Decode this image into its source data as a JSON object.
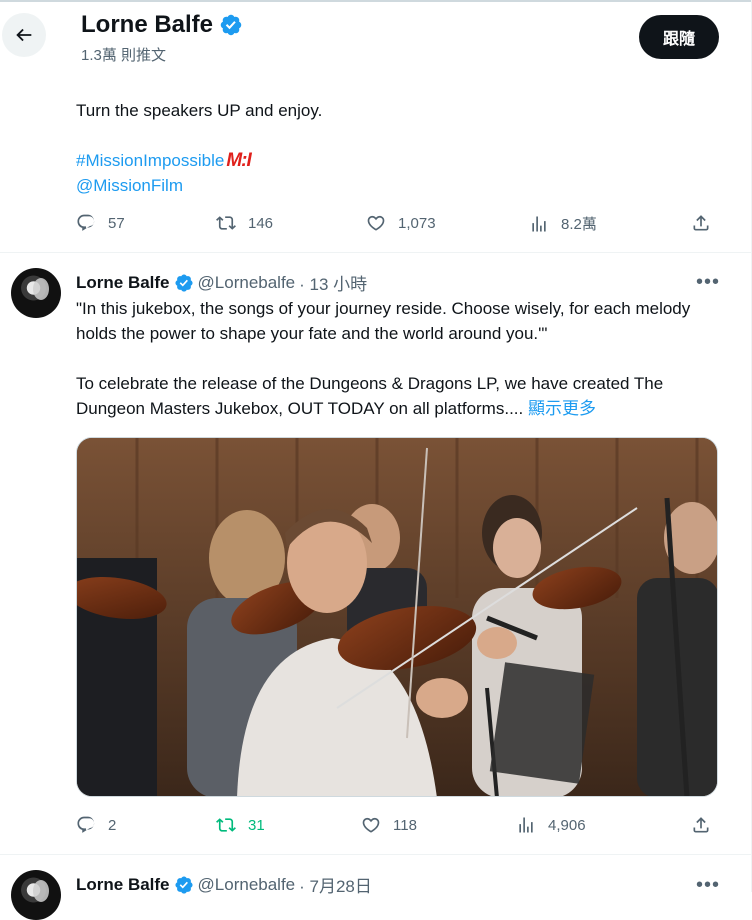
{
  "header": {
    "name": "Lorne Balfe",
    "post_count": "1.3萬 則推文",
    "follow_label": "跟隨"
  },
  "tweet1": {
    "text": "Turn the speakers UP and enjoy.",
    "hashtag": "#MissionImpossible",
    "hashtag_logo": "M:I",
    "mention": "@MissionFilm",
    "replies": "57",
    "retweets": "146",
    "likes": "1,073",
    "views": "8.2萬"
  },
  "tweet2": {
    "name": "Lorne Balfe",
    "handle": "@Lornebalfe",
    "time": "· 13 小時",
    "para1": "\"In this jukebox, the songs of your journey reside. Choose wisely, for each melody holds the power to shape your fate and the world around you.'\"",
    "para2": "To celebrate the release of the Dungeons & Dragons  LP, we have created The Dungeon Masters Jukebox, OUT TODAY on all platforms....",
    "show_more": "顯示更多",
    "replies": "2",
    "retweets": "31",
    "likes": "118",
    "views": "4,906",
    "media_description": "orchestra violinists recording"
  },
  "tweet3": {
    "name": "Lorne Balfe",
    "handle": "@Lornebalfe",
    "time": "· 7月28日"
  },
  "colors": {
    "accent": "#1d9bf0",
    "text": "#0f1419",
    "muted": "#536471",
    "retweet_active": "#00ba7c",
    "verified": "#1d9bf0"
  }
}
